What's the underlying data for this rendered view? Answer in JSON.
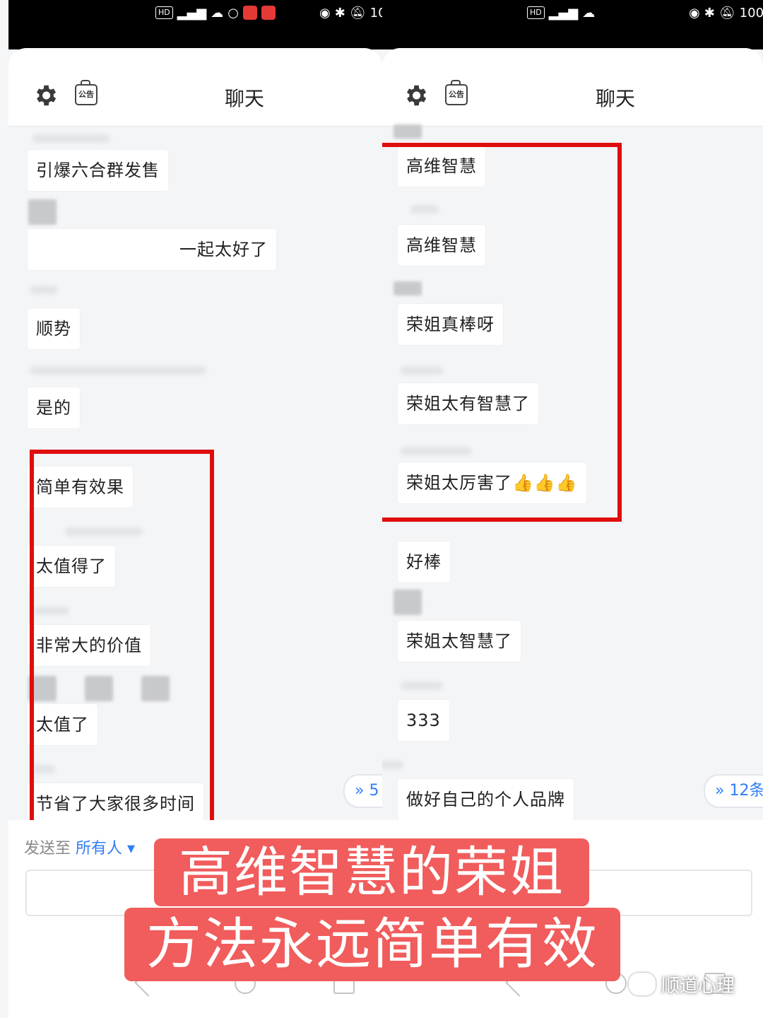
{
  "left": {
    "status": {
      "right_text": "10"
    },
    "header": {
      "title": "聊天",
      "notice_label": "公告"
    },
    "messages": [
      "引爆六合群发售",
      "一起太好了",
      "顺势",
      "是的",
      "简单有效果",
      "太值得了",
      "非常大的价值",
      "太值了",
      "节省了大家很多时间"
    ],
    "jump_count": "5",
    "composer": {
      "send_to_label": "发送至",
      "send_to_value": "所有人"
    }
  },
  "right": {
    "status": {
      "right_text": "100"
    },
    "header": {
      "title": "聊天",
      "notice_label": "公告"
    },
    "messages": [
      "高维智慧",
      "高维智慧",
      "荣姐真棒呀",
      "荣姐太有智慧了",
      "荣姐太厉害了👍👍👍",
      "好棒",
      "荣姐太智慧了",
      "333",
      "做好自己的个人品牌"
    ],
    "jump_count": "12条"
  },
  "caption": {
    "line1": "高维智慧的荣姐",
    "line2": "方法永远简单有效"
  },
  "watermark": "顺道心理",
  "colors": {
    "highlight_box": "#e00d0d",
    "caption_bg": "#f15c5c",
    "link_blue": "#2f7df6"
  },
  "icons": [
    "settings-gear-icon",
    "announcement-icon",
    "double-chevron-down-icon"
  ]
}
